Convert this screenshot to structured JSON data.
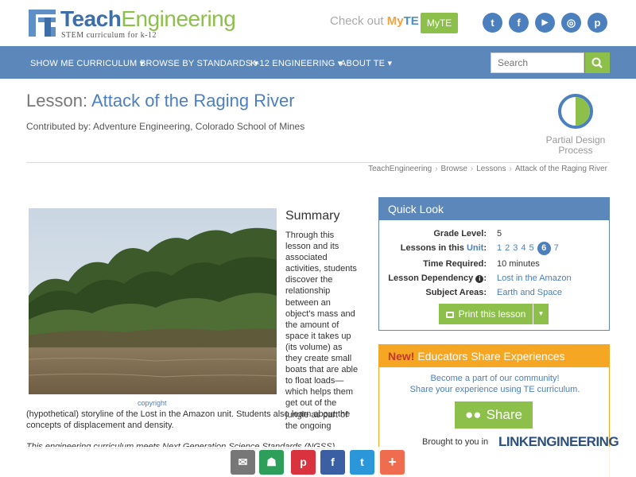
{
  "header": {
    "logo_part1": "Teach",
    "logo_part2": "Engineering",
    "logo_tagline": "STEM curriculum for k-12",
    "checkout_text": "Check out",
    "checkout_my": "My",
    "checkout_te": "TE",
    "myte_button": "MyTE",
    "social": [
      {
        "name": "twitter",
        "glyph": "t"
      },
      {
        "name": "facebook",
        "glyph": "f"
      },
      {
        "name": "youtube",
        "glyph": "▶"
      },
      {
        "name": "instagram",
        "glyph": "◎"
      },
      {
        "name": "pinterest",
        "glyph": "p"
      }
    ]
  },
  "nav": {
    "items": [
      {
        "label": "SHOW ME CURRICULUM ▾"
      },
      {
        "label": "BROWSE BY STANDARDS ▾"
      },
      {
        "label": "K-12 ENGINEERING ▾"
      },
      {
        "label": "ABOUT TE ▾"
      }
    ],
    "search_placeholder": "Search"
  },
  "lesson": {
    "prefix": "Lesson: ",
    "title": "Attack of the Raging River",
    "contributed": "Contributed by: Adventure Engineering, Colorado School of Mines",
    "design_label": "Partial Design Process"
  },
  "breadcrumb": [
    "TeachEngineering",
    "Browse",
    "Lessons",
    "Attack of the Raging River"
  ],
  "summary": {
    "heading": "Summary",
    "text_narrow": "Through this lesson and its associated activities, students discover the relationship between an object's mass and the amount of space it takes up (its volume) as they create small boats that are able to float loads—which helps them get out of the jungle as part of the ongoing",
    "text_wide": "(hypothetical) storyline of the Lost in the Amazon unit. Students also learn about the concepts of displacement and density.",
    "ngss": "This engineering curriculum meets Next Generation Science Standards (NGSS).",
    "copyright": "copyright"
  },
  "quick_look": {
    "heading": "Quick Look",
    "grade_label": "Grade Level:",
    "grade_value": "5",
    "unit_label_prefix": "Lessons in this ",
    "unit_label_link": "Unit",
    "unit_label_suffix": ":",
    "unit_numbers": [
      "1",
      "2",
      "3",
      "4",
      "5",
      "6",
      "7"
    ],
    "unit_current": "6",
    "time_label": "Time Required:",
    "time_value": "10 minutes",
    "dep_label": "Lesson Dependency",
    "dep_value": "Lost in the Amazon",
    "subject_label": "Subject Areas:",
    "subject_value": "Earth and Space",
    "print_button": "Print this lesson"
  },
  "educators": {
    "new": "New!",
    "heading": " Educators Share Experiences",
    "line1": "Become a part of our community!",
    "line2": "Share your experience using TE curriculum.",
    "share_button": "Share",
    "brought": "Brought to you in",
    "partner": "LINKENGINEERING"
  },
  "float_share": [
    {
      "name": "email",
      "glyph": "✉",
      "color": "#777777"
    },
    {
      "name": "classroom",
      "glyph": "☗",
      "color": "#2e9e5b"
    },
    {
      "name": "pinterest",
      "glyph": "p",
      "color": "#d9333f"
    },
    {
      "name": "facebook",
      "glyph": "f",
      "color": "#3b5fa3"
    },
    {
      "name": "twitter",
      "glyph": "t",
      "color": "#2b97d8"
    },
    {
      "name": "more",
      "glyph": "+",
      "color": "#ef6c4f"
    }
  ]
}
